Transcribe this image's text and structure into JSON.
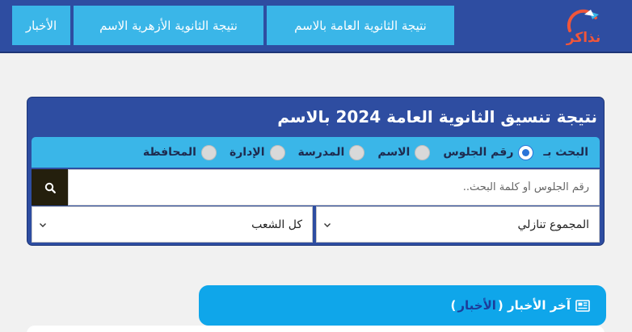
{
  "brand": {
    "logo_text": "نذاكر",
    "logo_color": "#f0563a"
  },
  "nav": {
    "tabs": [
      {
        "label": "نتيجة الثانوية العامة بالاسم"
      },
      {
        "label": "نتيجة الثانوية الأزهرية الاسم"
      },
      {
        "label": "الأخبار"
      }
    ]
  },
  "search_card": {
    "title": "نتيجة تنسيق الثانوية العامة 2024 بالاسم",
    "search_by_label": "البحث بـ",
    "options": [
      {
        "label": "رقم الجلوس",
        "checked": true
      },
      {
        "label": "الاسم",
        "checked": false
      },
      {
        "label": "المدرسة",
        "checked": false
      },
      {
        "label": "الإدارة",
        "checked": false
      },
      {
        "label": "المحافظة",
        "checked": false
      }
    ],
    "search_placeholder": "رقم الجلوس أو كلمة البحث..",
    "search_icon": "search-icon",
    "sort_select": "المجموع تنازلي",
    "branch_select": "كل الشعب"
  },
  "news": {
    "title_prefix": "آخر الأخبار",
    "link_text": "الأخبار",
    "icon": "newspaper-icon"
  },
  "colors": {
    "primary": "#2e4da1",
    "accent": "#3ab6e8",
    "news_bar": "#0fa6ea",
    "search_button": "#241f0d",
    "radio_selected": "#2a73d8"
  }
}
